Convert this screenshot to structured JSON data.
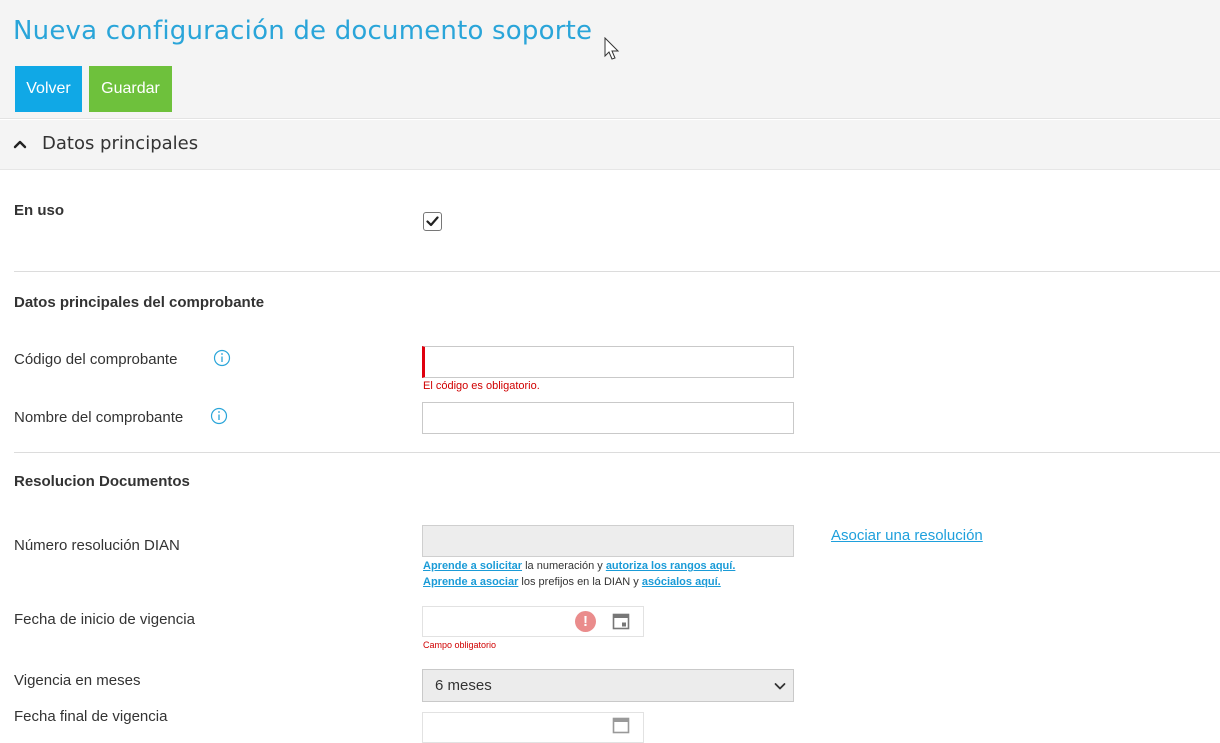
{
  "header": {
    "title": "Nueva configuración de documento soporte",
    "back_label": "Volver",
    "save_label": "Guardar",
    "back_color": "#10a8e6",
    "save_color": "#6ec13c"
  },
  "section": {
    "title": "Datos principales"
  },
  "fields": {
    "en_uso_label": "En uso",
    "en_uso_checked": true,
    "subsection_comprobante": "Datos principales del comprobante",
    "codigo_label": "Código del comprobante",
    "codigo_value": "",
    "codigo_error": "El código es obligatorio.",
    "nombre_label": "Nombre del comprobante",
    "nombre_value": "",
    "subsection_resolucion": "Resolucion Documentos",
    "resolucion_label": "Número resolución DIAN",
    "resolucion_value": "",
    "asociar_link": "Asociar una resolución",
    "help1": {
      "link1": "Aprende a solicitar",
      "text1": " la numeración y ",
      "link2": "autoriza los rangos aquí."
    },
    "help2": {
      "link1": "Aprende a asociar",
      "text1": " los prefijos en la DIAN y ",
      "link2": "asócialos aquí."
    },
    "fecha_inicio_label": "Fecha de inicio de vigencia",
    "fecha_inicio_error": "Campo obligatorio",
    "vigencia_label": "Vigencia en meses",
    "vigencia_value": "6 meses",
    "fecha_final_label": "Fecha final de vigencia"
  }
}
